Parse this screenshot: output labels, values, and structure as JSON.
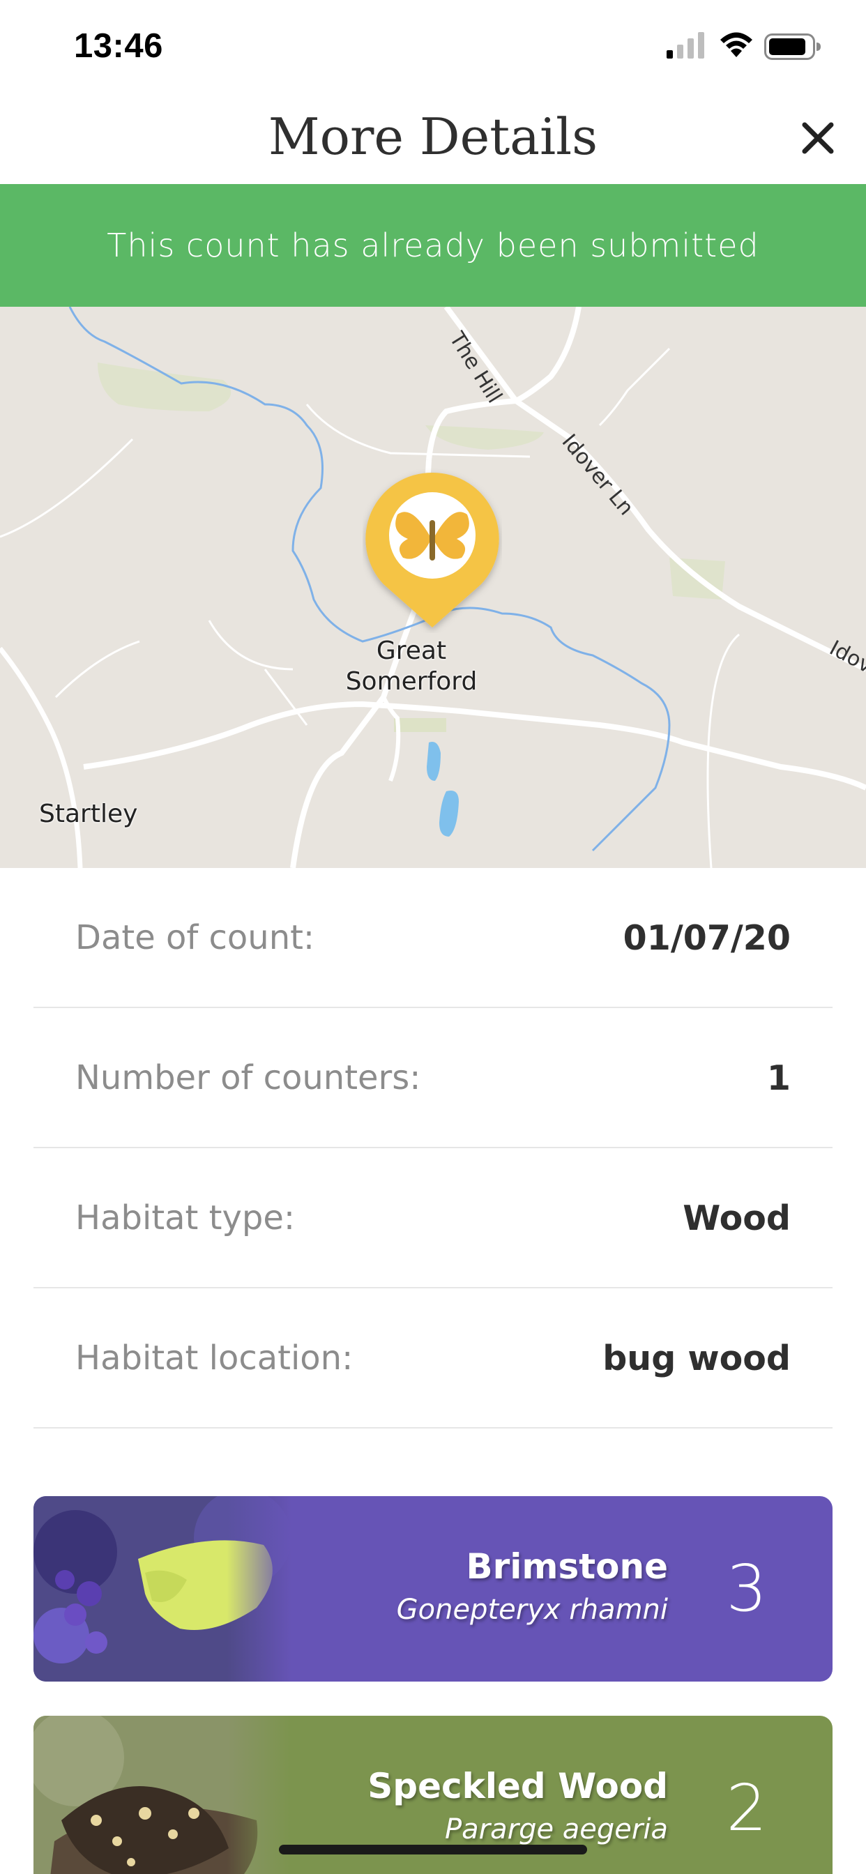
{
  "status_bar": {
    "time": "13:46",
    "icons": [
      "cellular-signal-icon",
      "wifi-icon",
      "battery-icon"
    ]
  },
  "header": {
    "title": "More Details",
    "close_icon": "close-icon"
  },
  "banner": {
    "text": "This count has already been submitted",
    "color": "#5bb865"
  },
  "map": {
    "place_labels": [
      "Great Somerford",
      "Startley"
    ],
    "road_labels": [
      "The Hill",
      "Idover Ln",
      "Idov"
    ],
    "pin_icon": "butterfly-pin-icon"
  },
  "details": [
    {
      "label": "Date of count:",
      "value": "01/07/20"
    },
    {
      "label": "Number of counters:",
      "value": "1"
    },
    {
      "label": "Habitat type:",
      "value": "Wood"
    },
    {
      "label": "Habitat location:",
      "value": "bug wood"
    }
  ],
  "species": [
    {
      "name": "Brimstone",
      "latin": "Gonepteryx rhamni",
      "count": "3",
      "color": "#6654b6"
    },
    {
      "name": "Speckled Wood",
      "latin": "Pararge aegeria",
      "count": "2",
      "color": "#7c944e"
    }
  ]
}
